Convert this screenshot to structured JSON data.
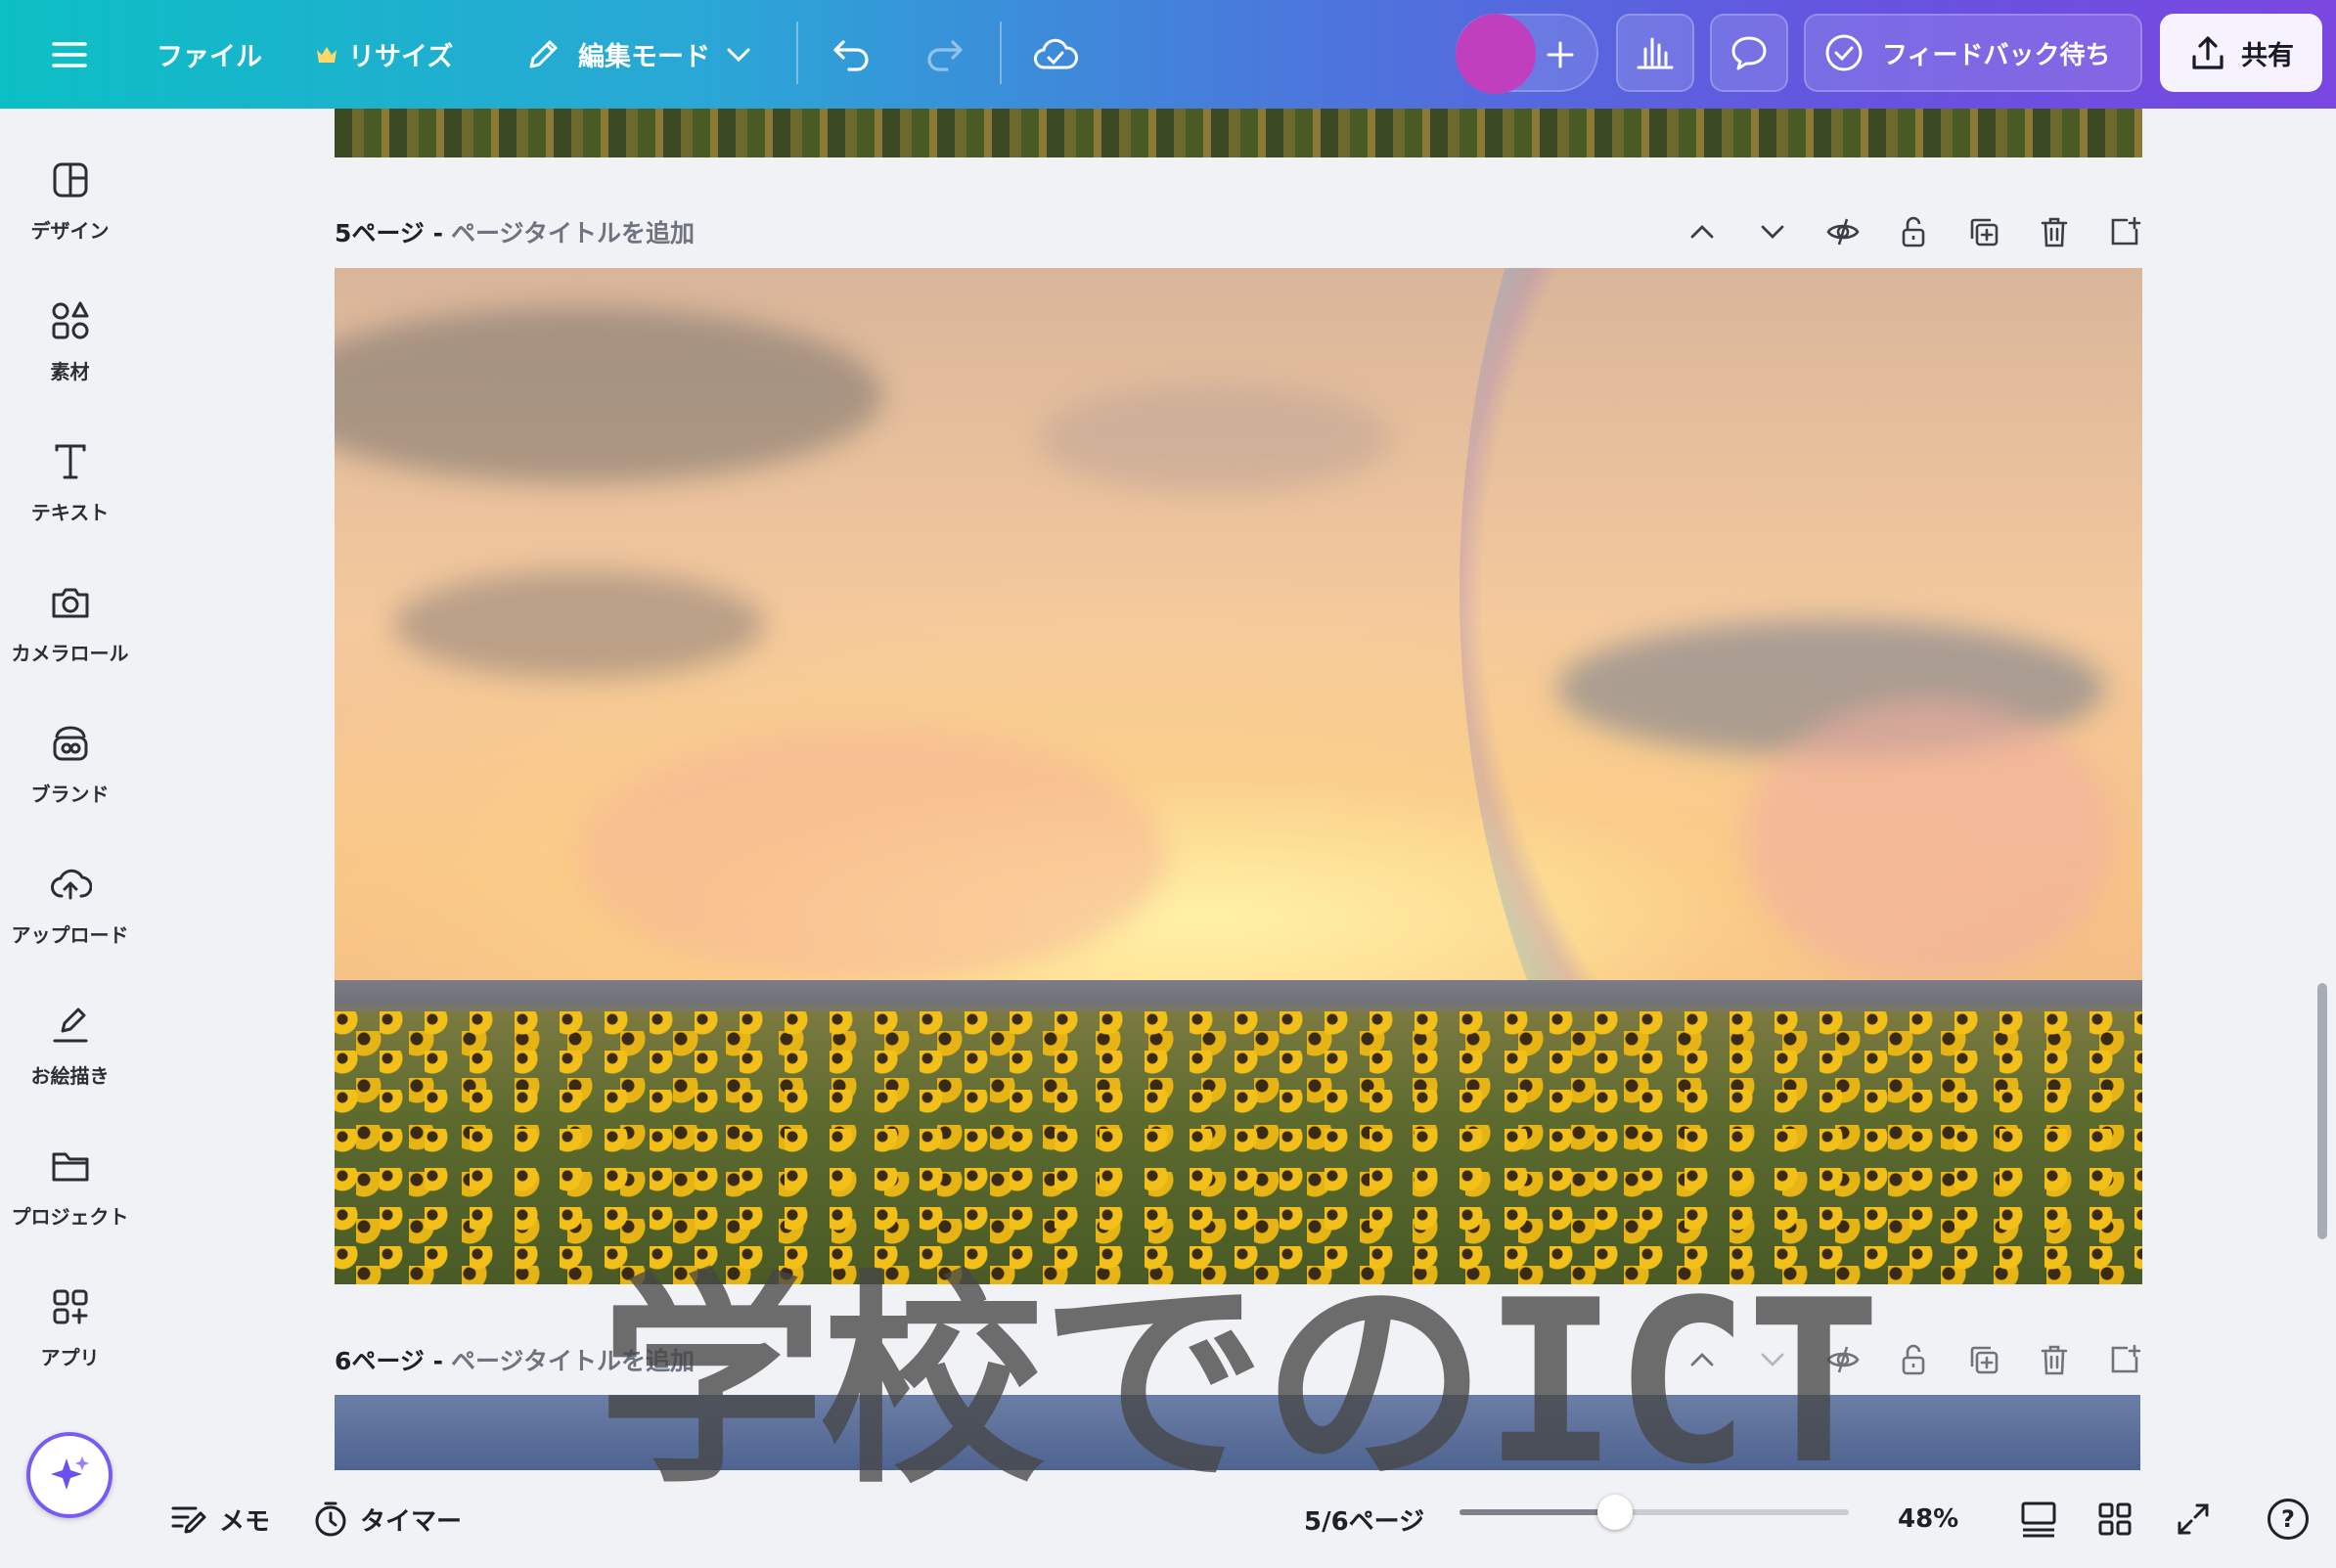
{
  "topbar": {
    "file_label": "ファイル",
    "resize_label": "リサイズ",
    "edit_mode_label": "編集モード",
    "feedback_label": "フィードバック待ち",
    "share_label": "共有",
    "avatar_color": "#c03fbf"
  },
  "sidebar": {
    "items": [
      {
        "label": "デザイン",
        "icon": "design-icon"
      },
      {
        "label": "素材",
        "icon": "elements-icon"
      },
      {
        "label": "テキスト",
        "icon": "text-icon"
      },
      {
        "label": "カメラロール",
        "icon": "camera-icon"
      },
      {
        "label": "ブランド",
        "icon": "brand-icon"
      },
      {
        "label": "アップロード",
        "icon": "upload-icon"
      },
      {
        "label": "お絵描き",
        "icon": "draw-icon"
      },
      {
        "label": "プロジェクト",
        "icon": "folder-icon"
      },
      {
        "label": "アプリ",
        "icon": "apps-icon"
      }
    ]
  },
  "pages": [
    {
      "number": "5ページ -",
      "title_placeholder": "ページタイトルを追加"
    },
    {
      "number": "6ページ -",
      "title_placeholder": "ページタイトルを追加"
    }
  ],
  "watermark_text": "学校でのICT",
  "bottombar": {
    "notes_label": "メモ",
    "timer_label": "タイマー",
    "page_indicator": "5/6ページ",
    "zoom_label": "48%",
    "page_slider_fraction": 0.4,
    "help_label": "?"
  },
  "colors": {
    "accent_purple": "#7a5af5",
    "topbar_start": "#0cbfc4",
    "topbar_end": "#7a47e0"
  }
}
